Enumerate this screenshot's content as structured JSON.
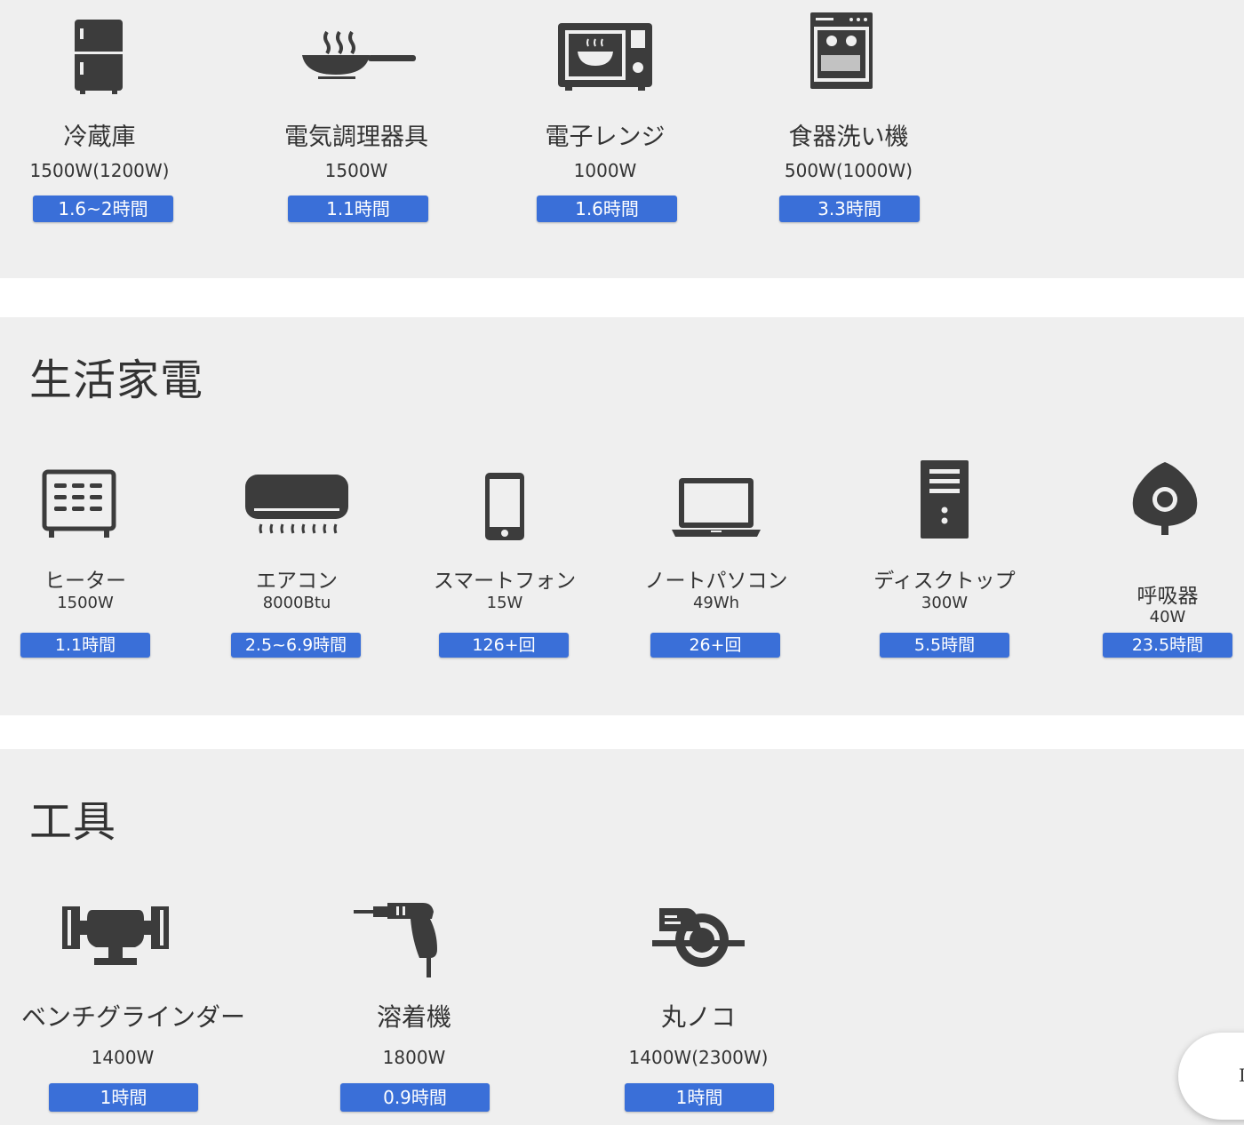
{
  "kitchen": {
    "items": [
      {
        "icon": "refrigerator-icon",
        "name": "冷蔵庫",
        "watt": "1500W(1200W)",
        "time": "1.6~2時間"
      },
      {
        "icon": "frying-pan-icon",
        "name": "電気調理器具",
        "watt": "1500W",
        "time": "1.1時間"
      },
      {
        "icon": "microwave-icon",
        "name": "電子レンジ",
        "watt": "1000W",
        "time": "1.6時間"
      },
      {
        "icon": "dishwasher-icon",
        "name": "食器洗い機",
        "watt": "500W(1000W)",
        "time": "3.3時間"
      }
    ]
  },
  "life": {
    "title": "生活家電",
    "items": [
      {
        "icon": "heater-icon",
        "name": "ヒーター",
        "watt": "1500W",
        "time": "1.1時間"
      },
      {
        "icon": "air-conditioner-icon",
        "name": "エアコン",
        "watt": "8000Btu",
        "time": "2.5~6.9時間"
      },
      {
        "icon": "smartphone-icon",
        "name": "スマートフォン",
        "watt": "15W",
        "time": "126+回"
      },
      {
        "icon": "laptop-icon",
        "name": "ノートパソコン",
        "watt": "49Wh",
        "time": "26+回"
      },
      {
        "icon": "desktop-tower-icon",
        "name": "ディスクトップ",
        "watt": "300W",
        "time": "5.5時間"
      },
      {
        "icon": "respirator-icon",
        "name": "呼吸器",
        "watt": "40W",
        "time": "23.5時間"
      }
    ]
  },
  "tools": {
    "title": "工具",
    "items": [
      {
        "icon": "bench-grinder-icon",
        "name": "ベンチグラインダー",
        "watt": "1400W",
        "time": "1時間"
      },
      {
        "icon": "welder-drill-icon",
        "name": "溶着機",
        "watt": "1800W",
        "time": "0.9時間"
      },
      {
        "icon": "circular-saw-icon",
        "name": "丸ノコ",
        "watt": "1400W(2300W)",
        "time": "1時間"
      }
    ]
  },
  "corner_fragment": "I",
  "colors": {
    "badge": "#3a6fd8",
    "icon": "#3c3c3c",
    "panel": "#efefef"
  }
}
